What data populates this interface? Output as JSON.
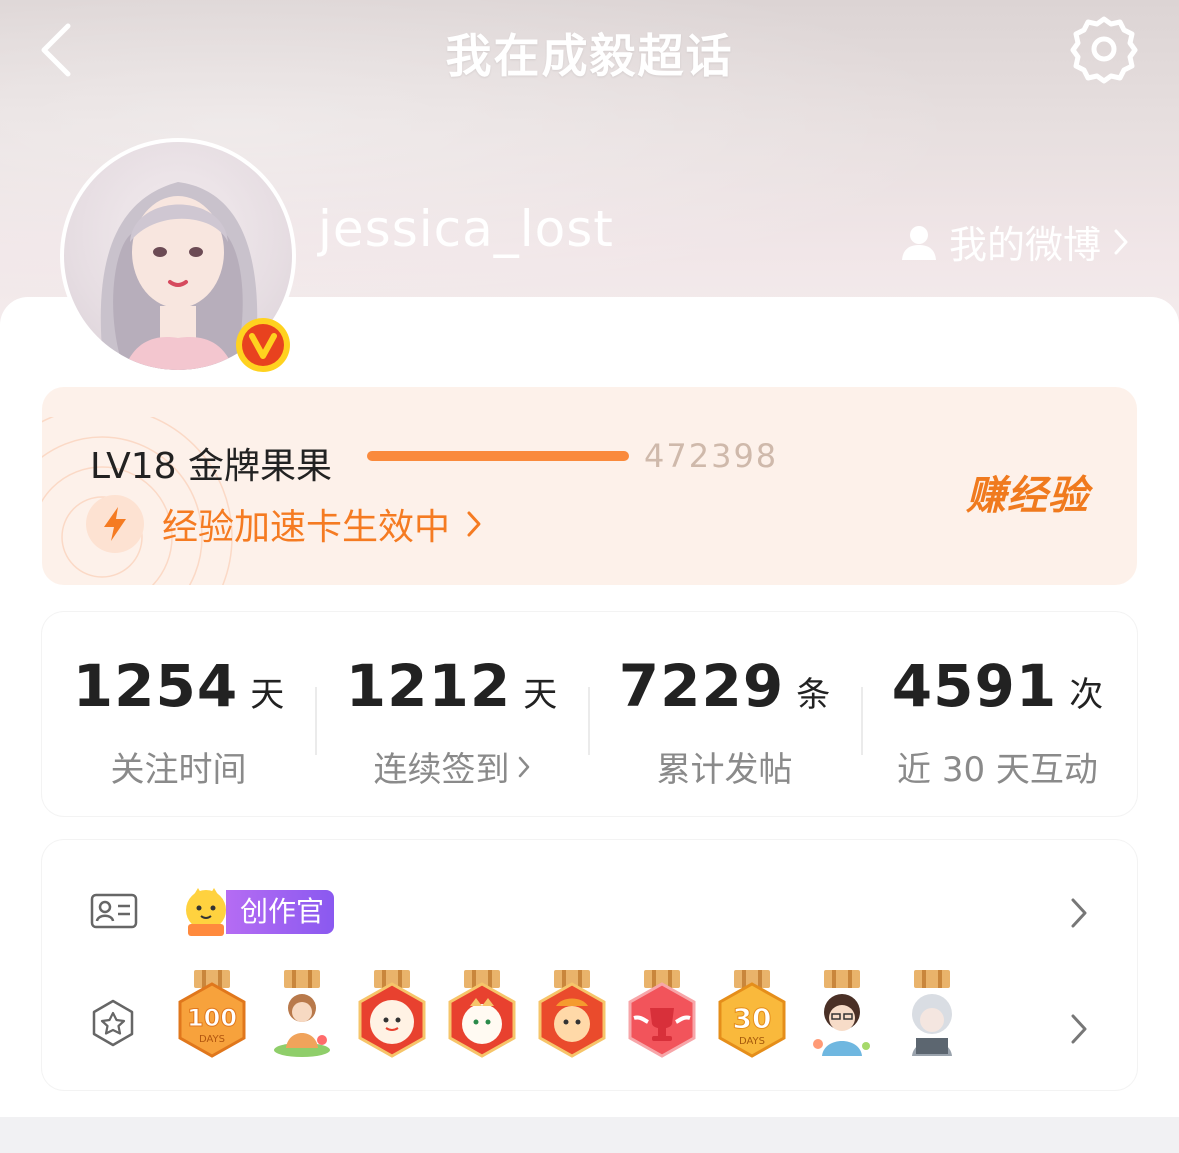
{
  "header": {
    "title": "我在成毅超话",
    "back_icon": "back-chevron-icon",
    "settings_icon": "gear-icon"
  },
  "profile": {
    "username": "jessica_lost",
    "my_weibo_label": "我的微博",
    "verified_badge": "V"
  },
  "level": {
    "label": "LV18 金牌果果",
    "exp_value": "472398",
    "exp_progress": 1.0,
    "boost_text": "经验加速卡生效中",
    "earn_button": "赚经验"
  },
  "stats": [
    {
      "value": "1254",
      "unit": "天",
      "label": "关注时间",
      "has_arrow": false
    },
    {
      "value": "1212",
      "unit": "天",
      "label": "连续签到",
      "has_arrow": true
    },
    {
      "value": "7229",
      "unit": "条",
      "label": "累计发帖",
      "has_arrow": false
    },
    {
      "value": "4591",
      "unit": "次",
      "label": "近 30 天互动",
      "has_arrow": false
    }
  ],
  "badges": {
    "creator_tag": "创作官",
    "medals": [
      {
        "name": "100-days-medal",
        "text": "100",
        "sub": "DAYS"
      },
      {
        "name": "character-medal-girl"
      },
      {
        "name": "dragon-medal-red-1"
      },
      {
        "name": "dragon-medal-red-2"
      },
      {
        "name": "dragon-medal-red-3"
      },
      {
        "name": "trophy-medal"
      },
      {
        "name": "30-days-medal",
        "text": "30",
        "sub": "DAYS"
      },
      {
        "name": "character-medal-boy"
      },
      {
        "name": "character-medal-silver"
      }
    ]
  },
  "colors": {
    "accent_orange": "#f57b22",
    "level_bg": "#fdf1ea",
    "creator_purple": "#9b5ff2"
  }
}
